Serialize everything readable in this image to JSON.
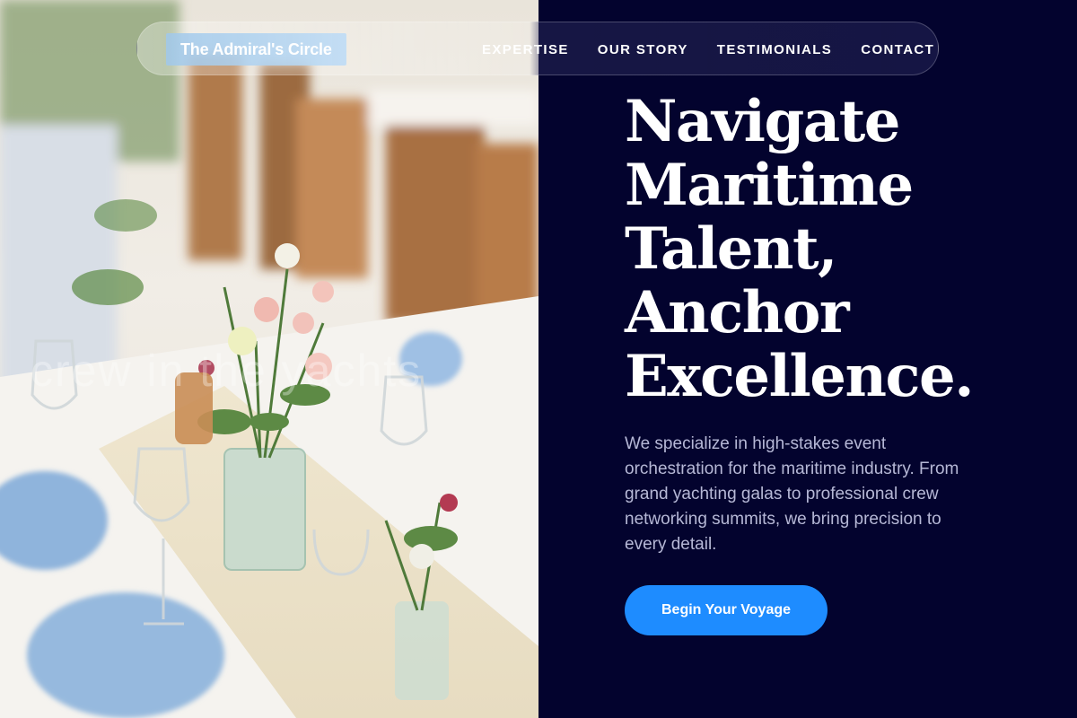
{
  "brand": {
    "name": "The Admiral's Circle"
  },
  "nav": {
    "links": [
      {
        "label": "EXPERTISE"
      },
      {
        "label": "OUR STORY"
      },
      {
        "label": "TESTIMONIALS"
      },
      {
        "label": "CONTACT"
      }
    ]
  },
  "hero": {
    "headline_lines": [
      "Navigate",
      "Maritime",
      "Talent,",
      "Anchor",
      "Excellence."
    ],
    "description": "We specialize in high-stakes event orchestration for the maritime industry. From grand yachting galas to professional crew networking summits, we bring precision to every detail.",
    "cta_label": "Begin Your Voyage"
  },
  "image": {
    "watermark": "crew in the yachts",
    "subject": "wedding-table-flowers-photo"
  },
  "colors": {
    "navy_background": "#03032e",
    "accent_blue": "#1e8cff",
    "description_text": "#b6b8d6"
  }
}
